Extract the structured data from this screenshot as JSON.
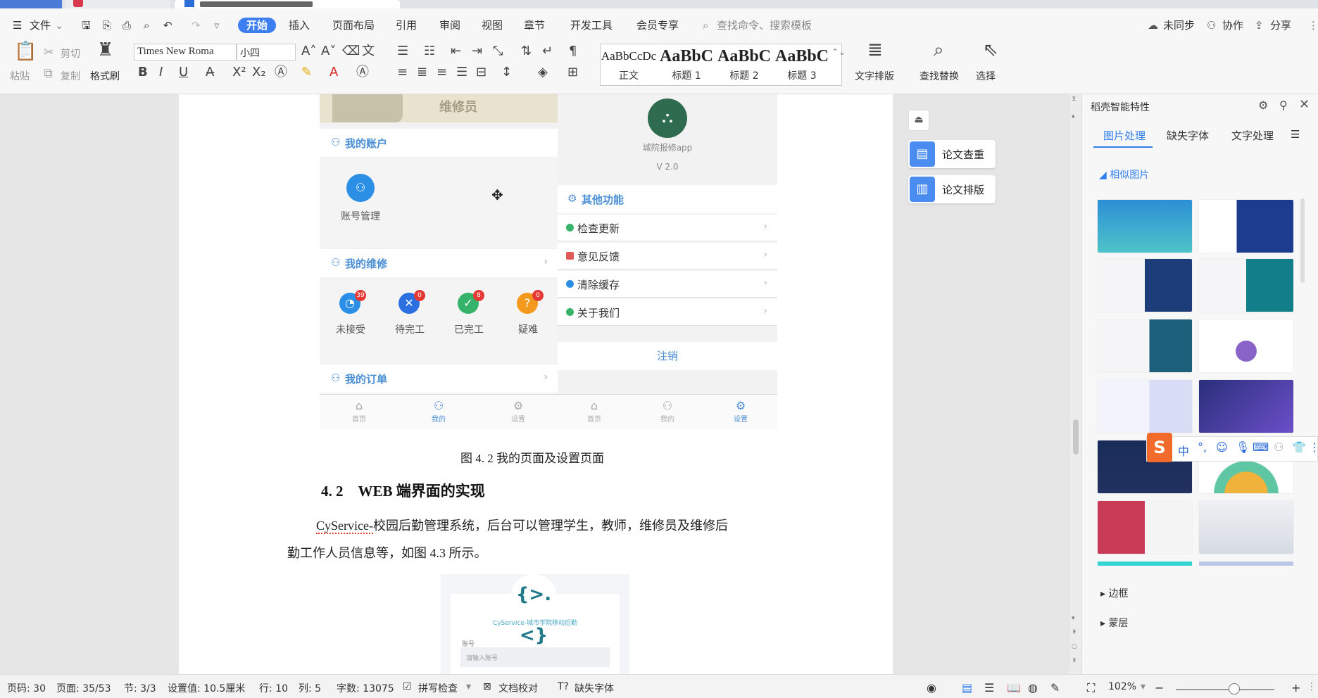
{
  "menu": {
    "file": "文件",
    "items": [
      "开始",
      "插入",
      "页面布局",
      "引用",
      "审阅",
      "视图",
      "章节",
      "开发工具",
      "会员专享"
    ],
    "search": "查找命令、搜索模板",
    "unsynced": "未同步",
    "collab": "协作",
    "share": "分享"
  },
  "ribbon": {
    "paste": "粘贴",
    "cut": "剪切",
    "copy": "复制",
    "format_painter": "格式刷",
    "font": "Times New Roma",
    "size": "小四",
    "styles": [
      {
        "preview": "AaBbCcDc",
        "label": "正文"
      },
      {
        "preview": "AaBbC",
        "label": "标题 1"
      },
      {
        "preview": "AaBbC",
        "label": "标题 2"
      },
      {
        "preview": "AaBbC",
        "label": "标题 3"
      }
    ],
    "text_layout": "文字排版",
    "find_replace": "查找替换",
    "select": "选择"
  },
  "phone_left": {
    "banner": "维修员",
    "account_header": "我的账户",
    "account_manage": "账号管理",
    "repair_header": "我的维修",
    "items": [
      {
        "label": "未接受",
        "badge": "39",
        "color": "#2b8fe6",
        "glyph": "◔"
      },
      {
        "label": "待完工",
        "badge": "0",
        "color": "#2b6fe0",
        "glyph": "✕"
      },
      {
        "label": "已完工",
        "badge": "8",
        "color": "#35b36a",
        "glyph": "✓"
      },
      {
        "label": "疑难",
        "badge": "0",
        "color": "#f39a1e",
        "glyph": "?"
      }
    ],
    "order_header": "我的订单",
    "tabs": [
      "首页",
      "我的",
      "设置"
    ]
  },
  "phone_right": {
    "app_name": "城院报修app",
    "version": "V 2.0",
    "other_header": "其他功能",
    "rows": [
      {
        "label": "检查更新",
        "color": "#35b36a"
      },
      {
        "label": "意见反馈",
        "color": "#e05a5a"
      },
      {
        "label": "清除缓存",
        "color": "#2b8fe6"
      },
      {
        "label": "关于我们",
        "color": "#35b36a"
      }
    ],
    "logout": "注销",
    "tabs": [
      "首页",
      "我的",
      "设置"
    ]
  },
  "doc": {
    "caption": "图 4. 2 我的页面及设置页面",
    "heading": "4. 2　WEB 端界面的实现",
    "para1_a": "CyService-",
    "para1_b": "校园后勤管理系统，后台可以管理学生，教师，维修员及维修后",
    "para2": "勤工作人员信息等，如图 4.3 所示。",
    "fig2_logo": "{>.<}",
    "fig2_sub": "CyService-城市学院移动后勤",
    "fig2_label": "账号",
    "fig2_placeholder": "请输入账号"
  },
  "floats": {
    "check": "论文查重",
    "layout": "论文排版"
  },
  "panel": {
    "title": "稻壳智能特性",
    "tabs": [
      "图片处理",
      "缺失字体",
      "文字处理"
    ],
    "similar": "相似图片",
    "border": "边框",
    "mask": "蒙层"
  },
  "ime": {
    "zh": "中"
  },
  "status": {
    "page_code": "页码: 30",
    "page": "页面: 35/53",
    "section": "节: 3/3",
    "setting": "设置值: 10.5厘米",
    "row": "行: 10",
    "col": "列: 5",
    "words": "字数: 13075",
    "spell": "拼写检查",
    "proof": "文档校对",
    "missing_font": "缺失字体",
    "zoom": "102%"
  }
}
